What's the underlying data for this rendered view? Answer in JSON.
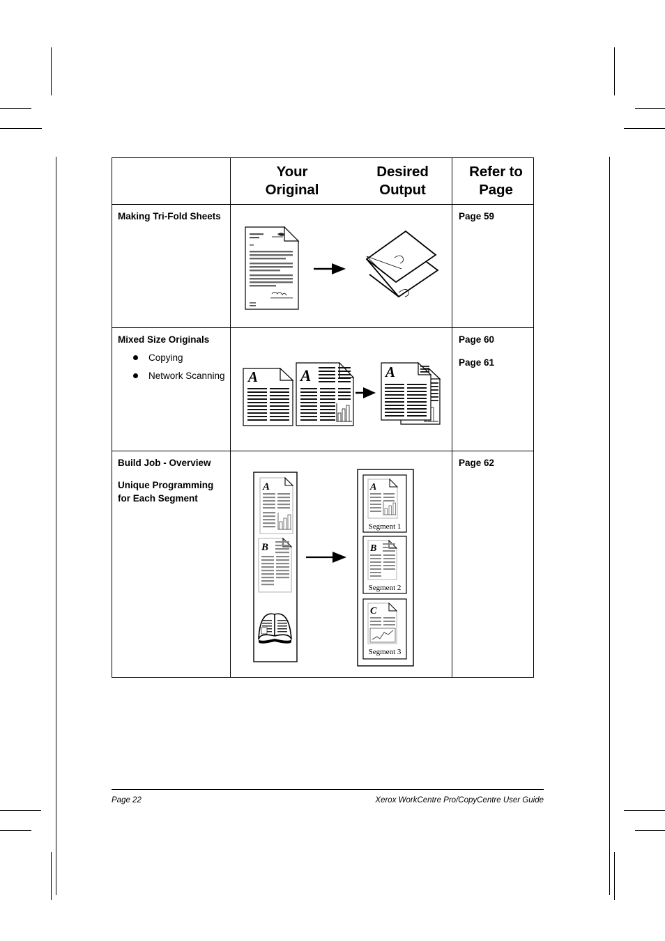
{
  "document": {
    "page_label": "Page 22",
    "guide_title": "Xerox WorkCentre Pro/CopyCentre User Guide"
  },
  "table": {
    "headers": {
      "feature": "",
      "your_original": "Your Original",
      "your_original_line1": "Your",
      "your_original_line2": "Original",
      "desired_output": "Desired Output",
      "desired_output_line1": "Desired",
      "desired_output_line2": "Output",
      "refer_to_page": "Refer to Page",
      "refer_to_page_line1": "Refer to",
      "refer_to_page_line2": "Page"
    },
    "rows": [
      {
        "feature_title": "Making Tri-Fold Sheets",
        "bullets": [],
        "illustration": "document-to-trifold-diagram",
        "page_refs": [
          "Page 59"
        ]
      },
      {
        "feature_title": "Mixed Size Originals",
        "bullets": [
          "Copying",
          "Network Scanning"
        ],
        "illustration": "mixed-size-originals-diagram",
        "page_refs": [
          "Page 60",
          "Page 61"
        ]
      },
      {
        "feature_title_line1": "Build Job - Overview",
        "feature_title_line2": "Unique Programming for Each Segment",
        "bullets": [],
        "illustration": "build-job-segments-diagram",
        "segment_labels": [
          "Segment 1",
          "Segment 2",
          "Segment 3"
        ],
        "page_refs": [
          "Page 62"
        ]
      }
    ]
  },
  "illustration_labels": {
    "segment_1": "Segment 1",
    "segment_2": "Segment 2",
    "segment_3": "Segment 3",
    "letter_a": "A",
    "letter_b": "B",
    "letter_c": "C"
  },
  "colors": {
    "ink": "#000000",
    "paper": "#ffffff",
    "rule_gray": "#808080",
    "light_gray": "#c8c8c8"
  }
}
